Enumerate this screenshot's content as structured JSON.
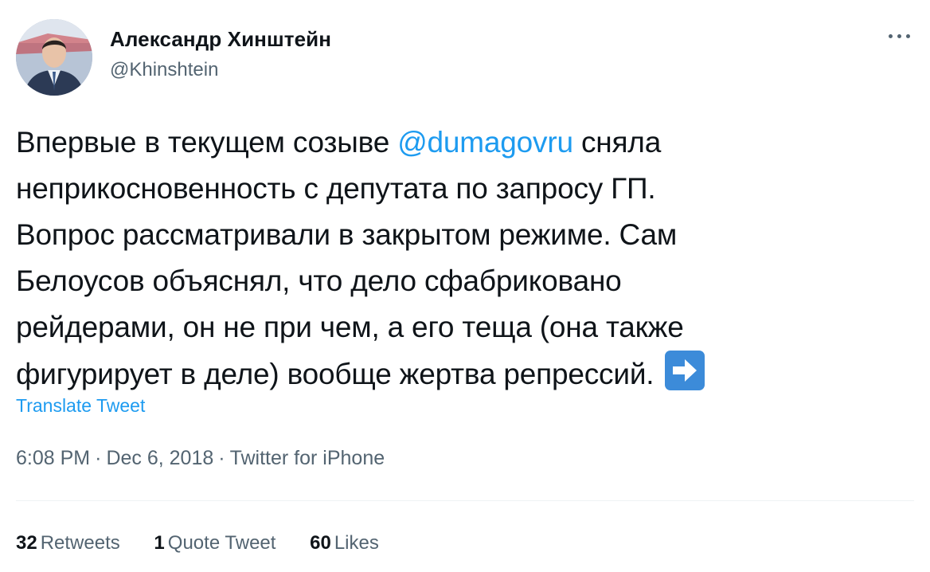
{
  "author": {
    "display_name": "Александр Хинштейн",
    "handle": "@Khinshtein"
  },
  "icons": {
    "more": "more-dots-icon",
    "emoji": "right-arrow-emoji-icon",
    "avatar": "profile-avatar"
  },
  "tweet": {
    "lines": [
      {
        "before": "Впервые в текущем созыве ",
        "mention": "@dumagovru",
        "after": " сняла"
      },
      {
        "text": "неприкосновенность с депутата по запросу ГП."
      },
      {
        "text": "Вопрос рассматривали в закрытом режиме. Сам"
      },
      {
        "text": "Белоусов объяснял, что дело сфабриковано"
      },
      {
        "text": "рейдерами, он не при чем, а его теща (она также"
      },
      {
        "text": "фигурирует в деле) вообще жертва репрессий."
      }
    ]
  },
  "translate_label": "Translate Tweet",
  "meta": {
    "time": "6:08 PM",
    "separator": "·",
    "date": "Dec 6, 2018",
    "source": "Twitter for iPhone"
  },
  "stats": {
    "retweets": {
      "count": "32",
      "label": "Retweets"
    },
    "quotes": {
      "count": "1",
      "label": "Quote Tweet"
    },
    "likes": {
      "count": "60",
      "label": "Likes"
    }
  },
  "colors": {
    "accent": "#1d9bf0",
    "text_primary": "#0f1419",
    "text_secondary": "#536471",
    "divider": "#eff3f4",
    "emoji_bg": "#3c8bd9"
  }
}
